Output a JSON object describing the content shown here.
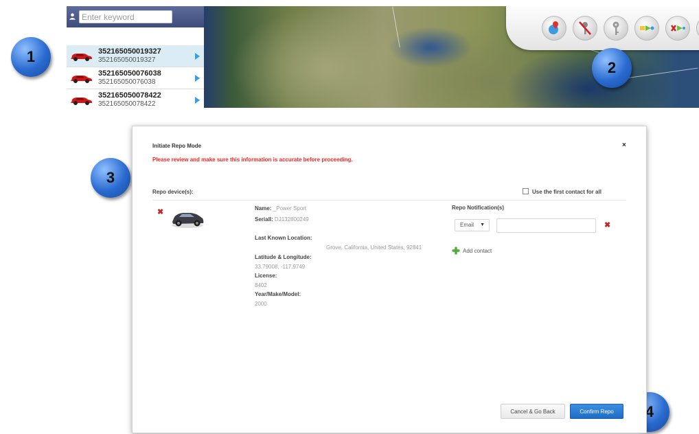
{
  "sidebar": {
    "search_placeholder": "Enter keyword",
    "devices": [
      {
        "title": "352165050019327",
        "subtitle": "352165050019327",
        "selected": true
      },
      {
        "title": "352165050076038",
        "subtitle": "352165050076038",
        "selected": false
      },
      {
        "title": "352165050078422",
        "subtitle": "352165050078422",
        "selected": false
      }
    ]
  },
  "toolbar": {
    "buttons": [
      "locate-icon",
      "no-key-icon",
      "key-icon",
      "send-icon",
      "cancel-send-icon",
      "add-icon",
      "calendar-icon",
      "upload-icon",
      "tow-truck-icon",
      "swap-icon"
    ],
    "edit_icon": "pencil-icon"
  },
  "badges": [
    "1",
    "2",
    "3",
    "4"
  ],
  "dialog": {
    "title": "Initiate Repo Mode",
    "close_symbol": "×",
    "warning": "Please review and make sure this information is accurate before proceeding.",
    "repo_devices_label": "Repo device(s):",
    "use_first_contact_label": "Use the first contact for all",
    "device": {
      "name_label": "Name:",
      "name_value": "_Power Sport",
      "serial_label": "SerialI:",
      "serial_value": "DJ132800249",
      "last_location_label": "Last Known Location:",
      "last_location_value": "Grove, California, United States, 92841",
      "latlng_label": "Latitude & Longitude:",
      "latlng_value": "33.79008, -117.9749",
      "license_label": "License:",
      "license_value": "8402",
      "ymm_label": "Year/Make/Model:",
      "ymm_value": "2000"
    },
    "notification": {
      "label": "Repo Notification(s)",
      "channel": "Email",
      "contact_value": "",
      "add_contact": "Add contact"
    },
    "cancel_button": "Cancel & Go Back",
    "confirm_button": "Confirm Repo"
  },
  "colors": {
    "warning": "#ff2020",
    "confirm": "#1f6cc4",
    "badge": "#2a6bd0",
    "remove": "#c3272b",
    "list_arrow": "#33a1e0"
  }
}
